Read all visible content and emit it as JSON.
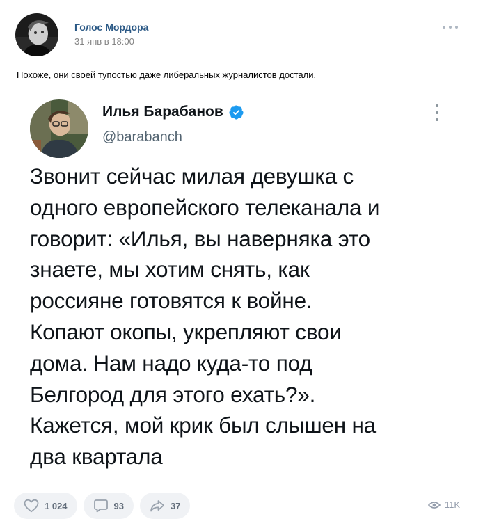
{
  "post": {
    "author_name": "Голос Мордора",
    "date": "31 янв в 18:00",
    "text": "Похоже, они своей тупостью даже либеральных журналистов достали."
  },
  "tweet": {
    "name": "Илья Барабанов",
    "handle": "@barabanch",
    "lines": [
      "Звонит сейчас милая девушка с",
      "одного европейского телеканала и",
      "говорит: «Илья, вы наверняка это",
      "знаете, мы хотим снять, как",
      "россияне готовятся к войне.",
      "Копают окопы, укрепляют свои",
      "дома. Нам надо куда-то под",
      "Белгород для этого ехать?».",
      "Кажется, мой крик был слышен на",
      "два квартала"
    ]
  },
  "actions": {
    "likes": "1 024",
    "comments": "93",
    "shares": "37",
    "views": "11K"
  },
  "icons": {
    "more": "more-horizontal-icon",
    "verified": "verified-badge-icon",
    "like": "heart-icon",
    "comment": "comment-icon",
    "share": "share-arrow-icon",
    "views": "eye-icon"
  },
  "colors": {
    "link": "#2a5885",
    "verified": "#1d9bf0",
    "action_bg": "#f0f2f5",
    "action_icon": "#99a2ad"
  }
}
